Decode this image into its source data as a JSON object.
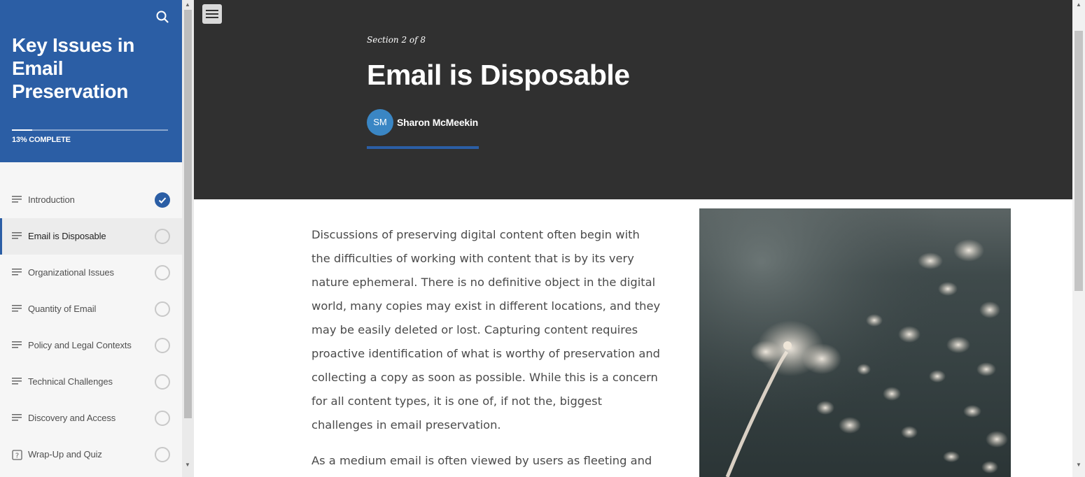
{
  "sidebar": {
    "course_title": "Key Issues in Email Preservation",
    "progress_label": "13% COMPLETE",
    "progress_fraction": 0.13,
    "lessons": [
      {
        "label": "Introduction",
        "icon": "lines-icon",
        "status": "complete"
      },
      {
        "label": "Email is Disposable",
        "icon": "lines-icon",
        "status": "incomplete",
        "active": true
      },
      {
        "label": "Organizational Issues",
        "icon": "lines-icon",
        "status": "incomplete"
      },
      {
        "label": "Quantity of Email",
        "icon": "lines-icon",
        "status": "incomplete"
      },
      {
        "label": "Policy and Legal Contexts",
        "icon": "lines-icon",
        "status": "incomplete"
      },
      {
        "label": "Technical Challenges",
        "icon": "lines-icon",
        "status": "incomplete"
      },
      {
        "label": "Discovery and Access",
        "icon": "lines-icon",
        "status": "incomplete"
      },
      {
        "label": "Wrap-Up and Quiz",
        "icon": "quiz-icon",
        "status": "incomplete"
      }
    ]
  },
  "lesson": {
    "section_label": "Section 2 of 8",
    "title": "Email is Disposable",
    "author_initials": "SM",
    "author_name": "Sharon McMeekin",
    "paragraphs": [
      "Discussions of preserving digital content often begin with the difficulties of working with content that is by its very nature ephemeral. There is no definitive object in the digital world, many copies may exist in different locations, and they may be easily deleted or lost. Capturing content requires proactive identification of what is worthy of preservation and collecting a copy as soon as possible. While this is a concern for all content types, it is one of, if not the, biggest challenges in email preservation.",
      "As a medium email is often viewed by users as fleeting and"
    ]
  },
  "colors": {
    "brand_blue": "#2b5ea5",
    "hero_bg": "#303030",
    "avatar_bg": "#3a86c4"
  }
}
